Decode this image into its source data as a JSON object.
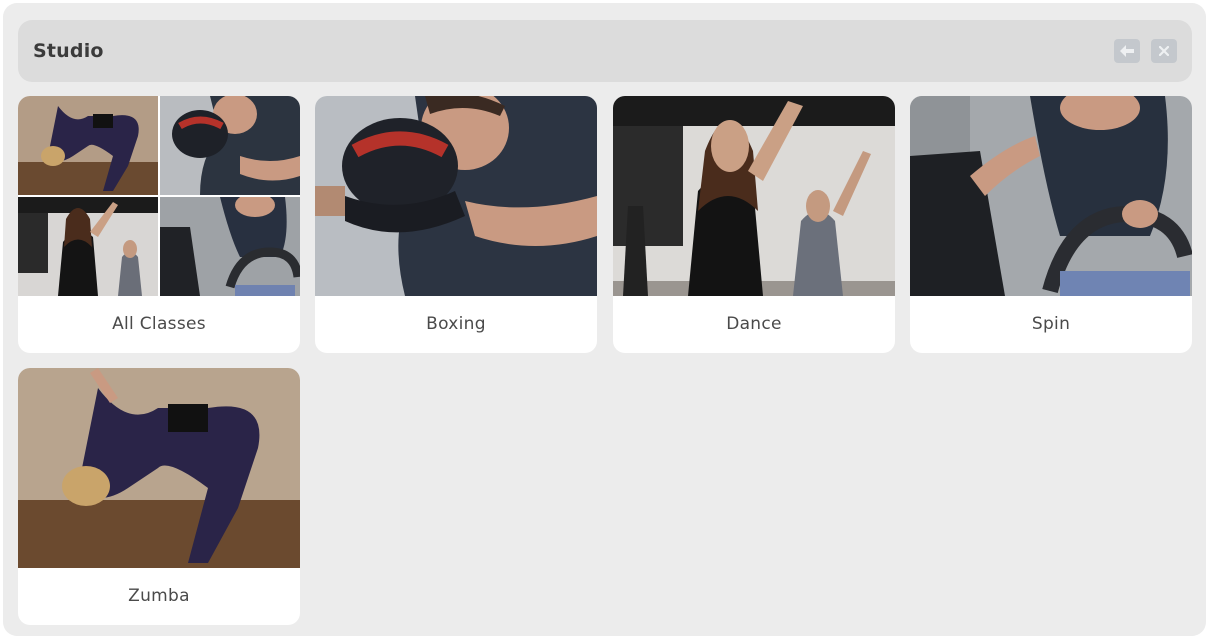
{
  "window": {
    "title": "Studio",
    "back_icon": "arrow-left-icon",
    "close_icon": "close-icon"
  },
  "colors": {
    "panel_bg": "#ececec",
    "header_bg": "#dcdcdc",
    "card_bg": "#ffffff",
    "button_bg": "#c4c8cd",
    "text": "#4a4a4a"
  },
  "classes": [
    {
      "label": "All Classes"
    },
    {
      "label": "Boxing"
    },
    {
      "label": "Dance"
    },
    {
      "label": "Spin"
    },
    {
      "label": "Zumba"
    }
  ]
}
